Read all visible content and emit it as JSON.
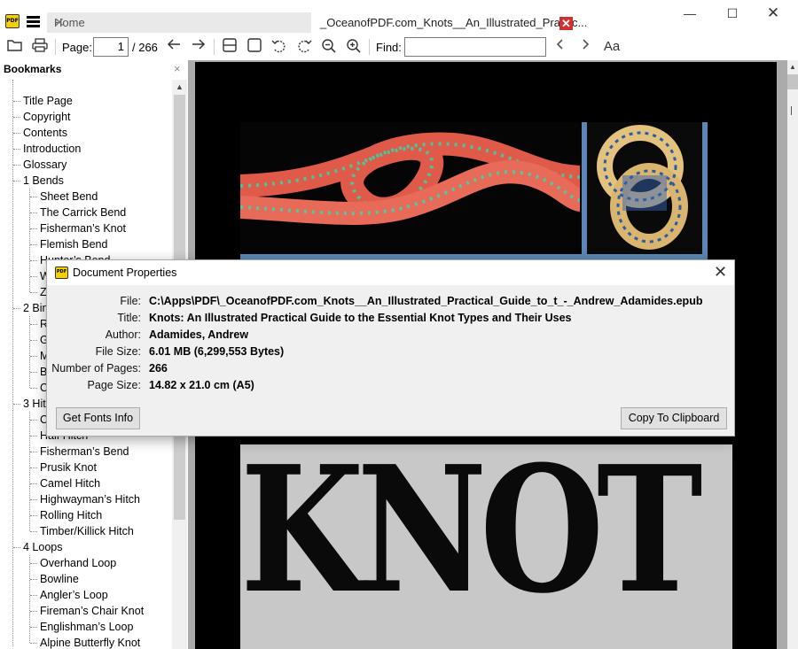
{
  "titlebar": {
    "home_tab": "Home",
    "home_tab_close": "✕",
    "doc_tab": "_OceanofPDF.com_Knots__An_Illustrated_Practic...",
    "doc_tab_close": "✕",
    "minimize": "—",
    "maximize": "☐",
    "close": "✕"
  },
  "toolbar": {
    "page_label": "Page:",
    "page_value": "1",
    "page_total": "/ 266",
    "find_label": "Find:",
    "find_value": "",
    "text_options_label": "Aa"
  },
  "bookmarks": {
    "title": "Bookmarks",
    "close": "×",
    "scroll_up": "▲",
    "items": [
      {
        "label": "Title Page",
        "level": 0
      },
      {
        "label": "Copyright",
        "level": 0
      },
      {
        "label": "Contents",
        "level": 0
      },
      {
        "label": "Introduction",
        "level": 0
      },
      {
        "label": "Glossary",
        "level": 0
      },
      {
        "label": "1 Bends",
        "level": 0
      },
      {
        "label": "Sheet Bend",
        "level": 1
      },
      {
        "label": "The Carrick Bend",
        "level": 1
      },
      {
        "label": "Fisherman’s Knot",
        "level": 1
      },
      {
        "label": "Flemish Bend",
        "level": 1
      },
      {
        "label": "Hunter’s Bend",
        "level": 1
      },
      {
        "label": "W",
        "level": 1
      },
      {
        "label": "Z",
        "level": 1
      },
      {
        "label": "2 Bin",
        "level": 0
      },
      {
        "label": "R",
        "level": 1
      },
      {
        "label": "G",
        "level": 1
      },
      {
        "label": "M",
        "level": 1
      },
      {
        "label": "B",
        "level": 1
      },
      {
        "label": "C",
        "level": 1
      },
      {
        "label": "3 Hit",
        "level": 0
      },
      {
        "label": "C",
        "level": 1
      },
      {
        "label": "Half Hitch",
        "level": 1
      },
      {
        "label": "Fisherman’s Bend",
        "level": 1
      },
      {
        "label": "Prusik Knot",
        "level": 1
      },
      {
        "label": "Camel Hitch",
        "level": 1
      },
      {
        "label": "Highwayman’s Hitch",
        "level": 1
      },
      {
        "label": "Rolling Hitch",
        "level": 1
      },
      {
        "label": "Timber/Killick Hitch",
        "level": 1
      },
      {
        "label": "4 Loops",
        "level": 0
      },
      {
        "label": "Overhand Loop",
        "level": 1
      },
      {
        "label": "Bowline",
        "level": 1
      },
      {
        "label": "Angler’s Loop",
        "level": 1
      },
      {
        "label": "Fireman’s Chair Knot",
        "level": 1
      },
      {
        "label": "Englishman’s Loop",
        "level": 1
      },
      {
        "label": "Alpine Butterfly Knot",
        "level": 1
      }
    ]
  },
  "document": {
    "cover_text": "KNOT",
    "scroll_up": "▲"
  },
  "dialog": {
    "title": "Document Properties",
    "close": "✕",
    "properties": [
      {
        "label": "File:",
        "value": "C:\\Apps\\PDF\\_OceanofPDF.com_Knots__An_Illustrated_Practical_Guide_to_t_-_Andrew_Adamides.epub"
      },
      {
        "label": "Title:",
        "value": "Knots: An Illustrated Practical Guide to the Essential Knot Types and Their Uses"
      },
      {
        "label": "Author:",
        "value": "Adamides, Andrew"
      },
      {
        "label": "File Size:",
        "value": "6.01 MB (6,299,553 Bytes)"
      },
      {
        "label": "Number of Pages:",
        "value": "266"
      },
      {
        "label": "Page Size:",
        "value": "14.82 x 21.0 cm (A5)"
      }
    ],
    "get_fonts_button": "Get Fonts Info",
    "copy_button": "Copy To Clipboard"
  }
}
